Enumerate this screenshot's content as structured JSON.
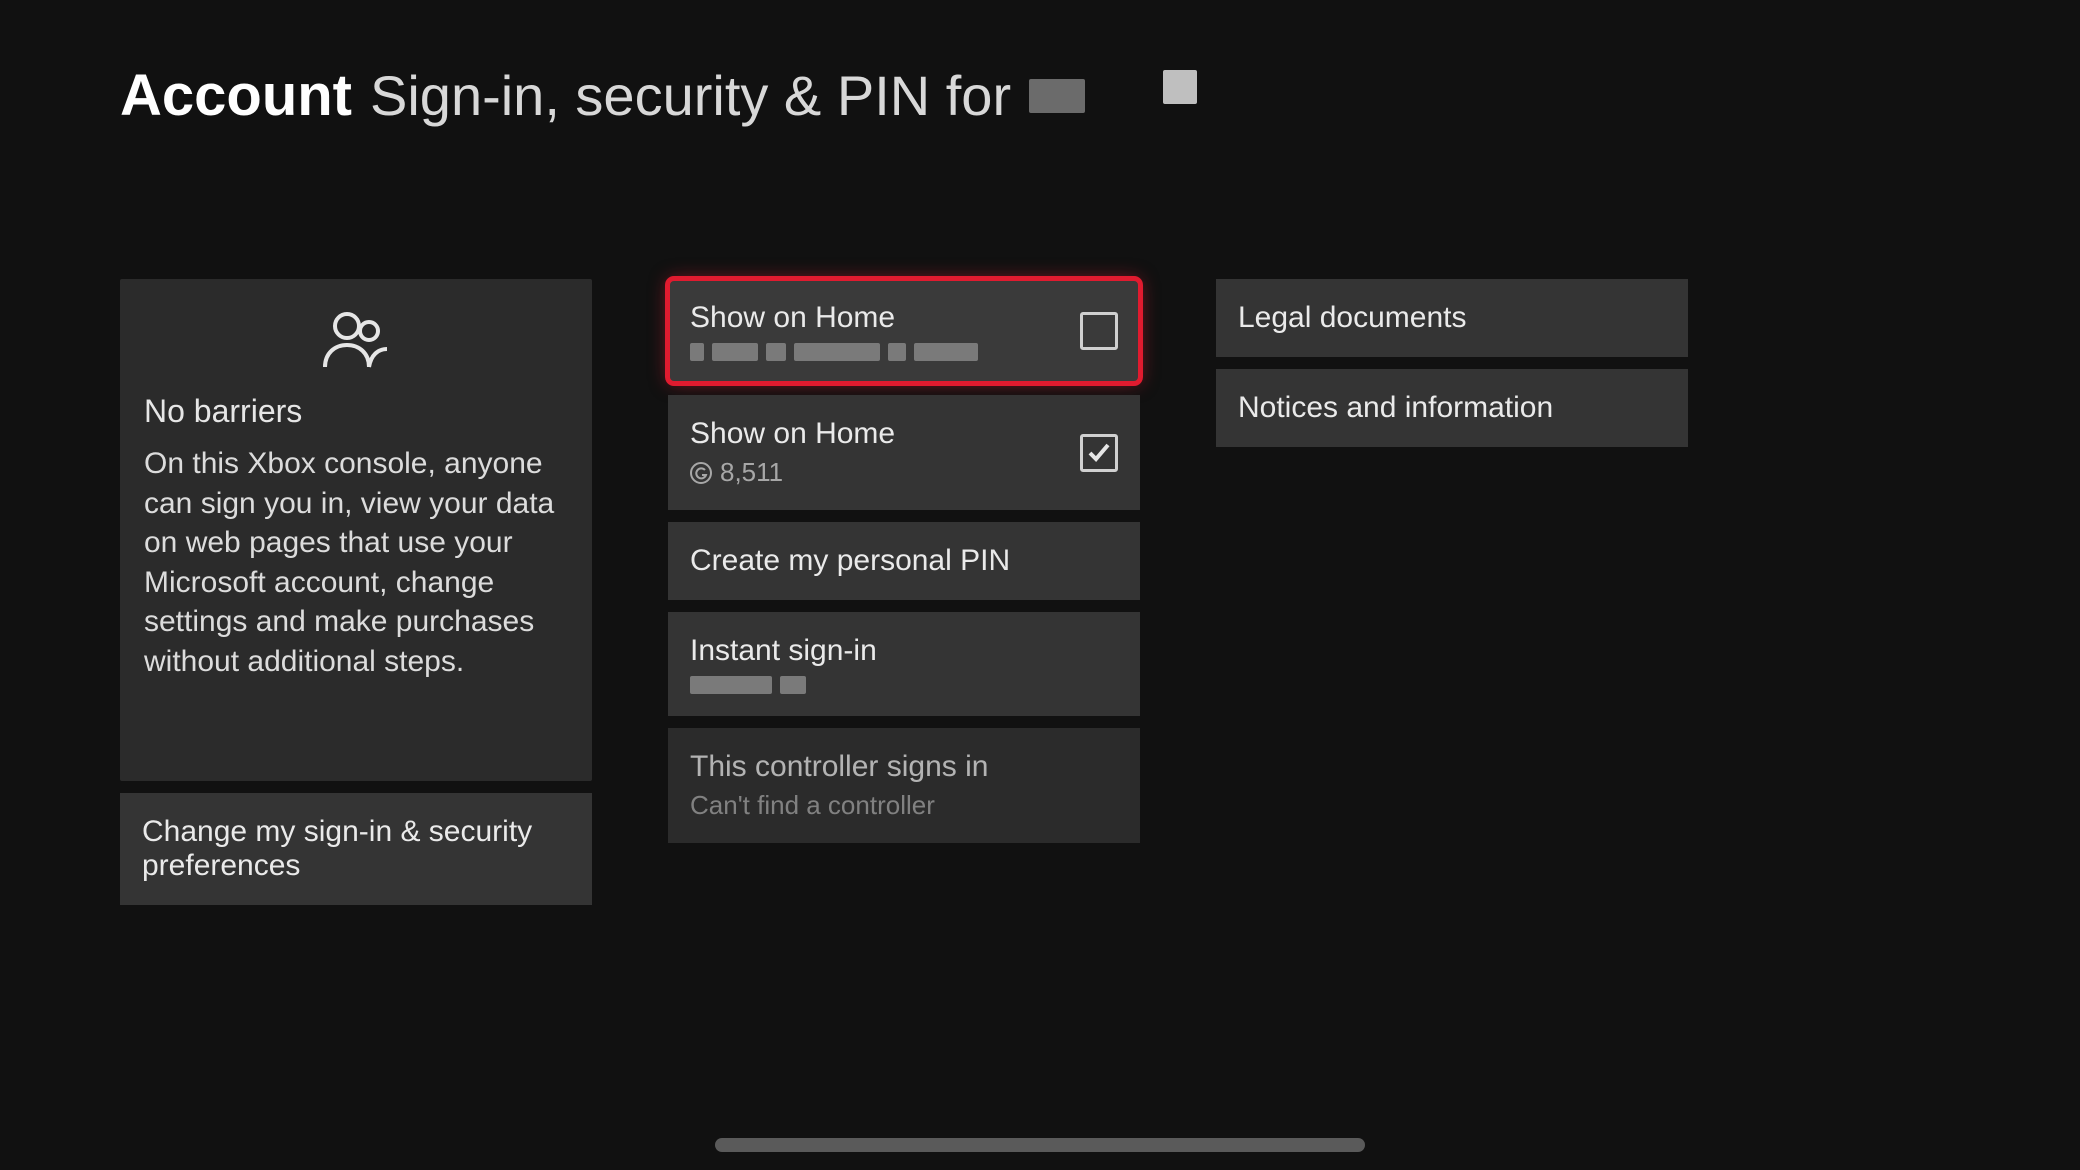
{
  "header": {
    "category": "Account",
    "title_prefix": "Sign-in, security & PIN for"
  },
  "sidebar": {
    "info": {
      "title": "No barriers",
      "description": "On this Xbox console, anyone can sign you in, view your data on web pages that use your Microsoft account, change settings and make purchases without additional steps."
    },
    "change_prefs_label": "Change my sign-in & security preferences"
  },
  "options": [
    {
      "label": "Show on Home",
      "subtitle_redacted": true,
      "checkbox": false,
      "highlighted": true
    },
    {
      "label": "Show on Home",
      "gamerscore": "8,511",
      "checkbox": true
    },
    {
      "label": "Create my personal PIN"
    },
    {
      "label": "Instant sign-in",
      "subtitle_redacted_short": true
    },
    {
      "label": "This controller signs in",
      "subtitle": "Can't find a controller",
      "disabled": true
    }
  ],
  "right": {
    "legal_label": "Legal documents",
    "notices_label": "Notices and information"
  }
}
